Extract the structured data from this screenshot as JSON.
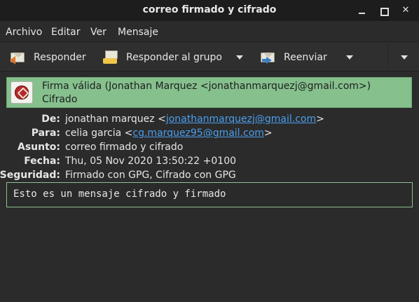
{
  "window": {
    "title": "correo firmado y cifrado"
  },
  "menu": {
    "items": [
      "Archivo",
      "Editar",
      "Ver",
      "Mensaje"
    ]
  },
  "toolbar": {
    "reply_label": "Responder",
    "reply_all_label": "Responder al grupo",
    "forward_label": "Reenviar"
  },
  "signature": {
    "status": "Firma válida (Jonathan Marquez <jonathanmarquezj@gmail.com>)",
    "encryption": "Cifrado",
    "color": "#86c08d"
  },
  "headers": {
    "from_label": "De:",
    "from_name": "jonathan marquez <",
    "from_email": "jonathanmarquezj@gmail.com",
    "from_close": ">",
    "to_label": "Para:",
    "to_name": "celia garcia <",
    "to_email": "cg.marquez95@gmail.com",
    "to_close": ">",
    "subject_label": "Asunto:",
    "subject": "correo firmado y cifrado",
    "date_label": "Fecha:",
    "date": "Thu, 05 Nov 2020 13:50:22 +0100",
    "security_label": "Seguridad:",
    "security": "Firmado con GPG, Cifrado con GPG"
  },
  "body": {
    "text": "Esto es un mensaje cifrado y firmado"
  },
  "icons": {
    "reply": "reply-envelope-icon",
    "reply_all": "reply-all-envelope-icon",
    "forward": "forward-envelope-icon",
    "seal": "signature-seal-icon"
  }
}
